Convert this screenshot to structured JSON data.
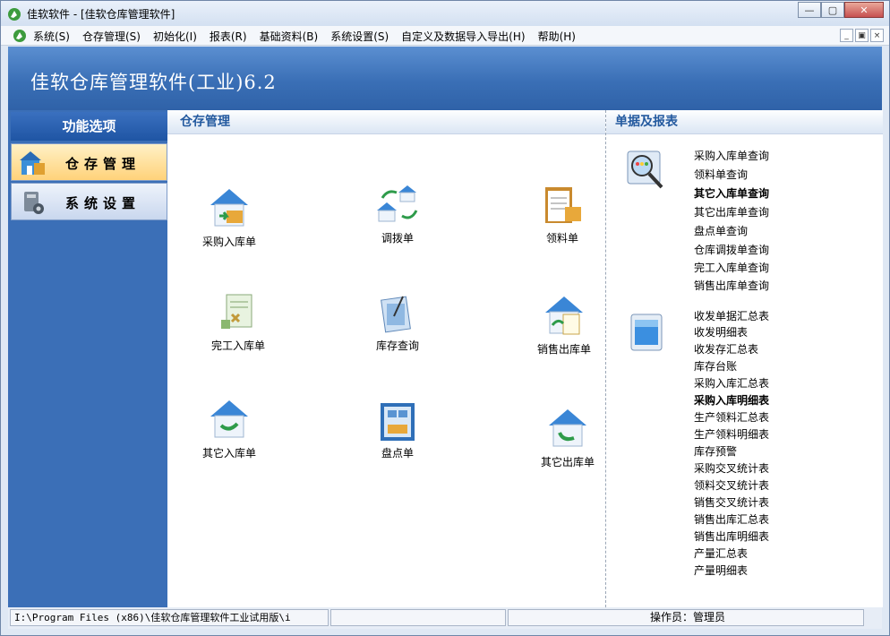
{
  "window": {
    "title": "佳软软件 - [佳软仓库管理软件]",
    "buttons": {
      "minimize": "▭",
      "maximize": "□",
      "close": "✕"
    }
  },
  "menu": {
    "items": [
      "系统(S)",
      "仓存管理(S)",
      "初始化(I)",
      "报表(R)",
      "基础资料(B)",
      "系统设置(S)",
      "自定义及数据导入导出(H)",
      "帮助(H)"
    ],
    "mdi": {
      "minimize": "_",
      "restore": "▣",
      "close": "×"
    }
  },
  "banner": {
    "title": "佳软仓库管理软件(工业)6.2"
  },
  "sidebar": {
    "header": "功能选项",
    "items": [
      {
        "label": "仓存管理",
        "icon": "warehouse-icon",
        "active": true
      },
      {
        "label": "系统设置",
        "icon": "settings-icon",
        "active": false
      }
    ]
  },
  "center": {
    "header": "仓存管理",
    "tiles": [
      {
        "label": "采购入库单",
        "icon": "purchase-inbound-icon"
      },
      {
        "label": "调拨单",
        "icon": "transfer-icon"
      },
      {
        "label": "领料单",
        "icon": "material-requisition-icon"
      },
      {
        "label": "完工入库单",
        "icon": "completion-inbound-icon"
      },
      {
        "label": "库存查询",
        "icon": "inventory-query-icon"
      },
      {
        "label": "销售出库单",
        "icon": "sales-outbound-icon"
      },
      {
        "label": "其它入库单",
        "icon": "other-inbound-icon"
      },
      {
        "label": "盘点单",
        "icon": "stocktake-icon"
      },
      {
        "label": "其它出库单",
        "icon": "other-outbound-icon"
      }
    ]
  },
  "right": {
    "header": "单据及报表",
    "queries": [
      "采购入库单查询",
      "领料单查询",
      "其它入库单查询",
      "其它出库单查询",
      "盘点单查询",
      "仓库调拨单查询",
      "完工入库单查询",
      "销售出库单查询"
    ],
    "queries_bold_index": 2,
    "reports": [
      "收发单据汇总表",
      "收发明细表",
      "收发存汇总表",
      "库存台账",
      "采购入库汇总表",
      "采购入库明细表",
      "生产领料汇总表",
      "生产领料明细表",
      "库存预警",
      "采购交叉统计表",
      "领料交叉统计表",
      "销售交叉统计表",
      "销售出库汇总表",
      "销售出库明细表",
      "产量汇总表",
      "产量明细表"
    ],
    "reports_bold_index": 5
  },
  "status": {
    "path": "I:\\Program Files (x86)\\佳软仓库管理软件工业试用版\\i",
    "middle": "",
    "operator": "操作员：管理员"
  }
}
